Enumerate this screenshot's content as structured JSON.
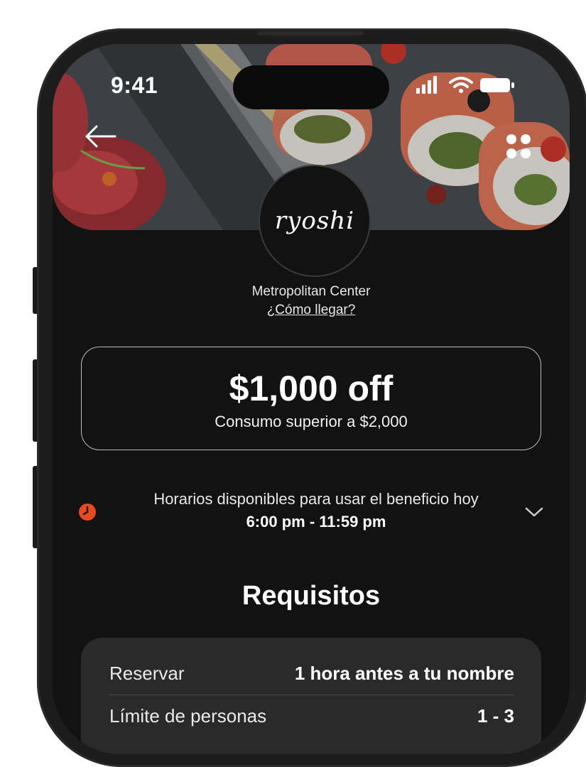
{
  "status_bar": {
    "time": "9:41"
  },
  "restaurant": {
    "logo_text": "ryoshi",
    "location": "Metropolitan Center",
    "directions_link": "¿Cómo llegar?"
  },
  "offer": {
    "title": "$1,000 off",
    "subtitle": "Consumo superior a $2,000"
  },
  "schedule": {
    "label": "Horarios disponibles para usar el beneficio hoy",
    "hours": "6:00 pm - 11:59 pm",
    "icon_color": "#e84a1f"
  },
  "requirements": {
    "title": "Requisitos",
    "rows": [
      {
        "label": "Reservar",
        "value": "1 hora antes a tu nombre"
      },
      {
        "label": "Límite de personas",
        "value": "1 - 3"
      }
    ]
  },
  "icons": {
    "back": "arrow-left-icon",
    "menu": "grid-dots-icon",
    "clock": "clock-icon",
    "chevron": "chevron-down-icon",
    "signal": "signal-icon",
    "wifi": "wifi-icon",
    "battery": "battery-icon"
  }
}
